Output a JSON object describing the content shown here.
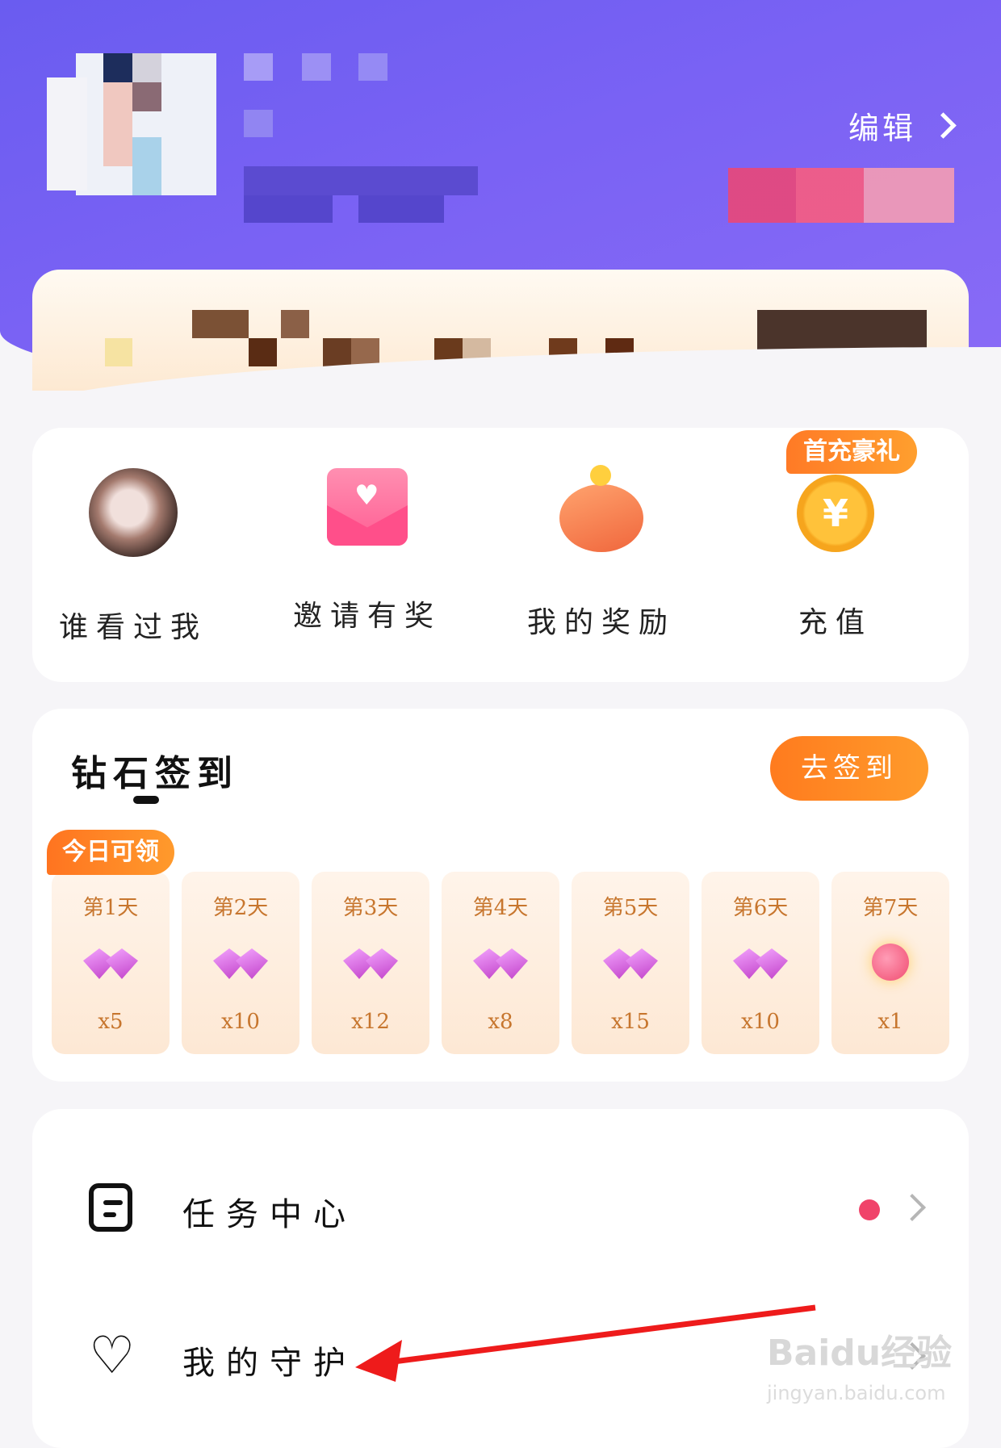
{
  "header": {
    "edit_label": "编辑",
    "colors": {
      "background": "#7561f2"
    }
  },
  "quick_actions": [
    {
      "label": "谁看过我",
      "icon": "visitor-avatar-icon"
    },
    {
      "label": "邀请有奖",
      "icon": "invite-envelope-icon"
    },
    {
      "label": "我的奖励",
      "icon": "piggy-bank-icon"
    },
    {
      "label": "充值",
      "icon": "coin-yen-icon",
      "tag": "首充豪礼",
      "glyph": "¥"
    }
  ],
  "checkin": {
    "title": "钻石签到",
    "button": "去签到",
    "today_tag": "今日可领",
    "days": [
      {
        "label": "第1天",
        "reward": "diamond",
        "count": "x5"
      },
      {
        "label": "第2天",
        "reward": "diamond",
        "count": "x10"
      },
      {
        "label": "第3天",
        "reward": "diamond",
        "count": "x12"
      },
      {
        "label": "第4天",
        "reward": "diamond",
        "count": "x8"
      },
      {
        "label": "第5天",
        "reward": "diamond",
        "count": "x15"
      },
      {
        "label": "第6天",
        "reward": "diamond",
        "count": "x10"
      },
      {
        "label": "第7天",
        "reward": "bomb",
        "count": "x1"
      }
    ]
  },
  "menu": [
    {
      "label": "任务中心",
      "icon": "task-list-icon",
      "has_dot": true
    },
    {
      "label": "我的守护",
      "icon": "guard-heart-icon",
      "has_dot": false
    }
  ],
  "watermark": {
    "main": "Baidu经验",
    "sub": "jingyan.baidu.com"
  },
  "colors": {
    "accent": "#ff8a24",
    "dot": "#f0436a",
    "annotation_arrow": "#ee1b1b"
  }
}
